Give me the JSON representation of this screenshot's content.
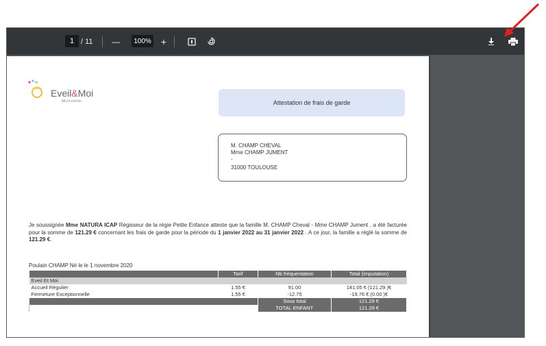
{
  "toolbar": {
    "current_page": "1",
    "page_total": "/ 11",
    "zoom_out_label": "—",
    "zoom_value": "100%",
    "zoom_in_label": "+",
    "fit_icon": "fit-page-icon",
    "rotate_icon": "rotate-icon",
    "download_icon": "download-icon",
    "print_icon": "print-icon"
  },
  "document": {
    "logo_name": "Eveil",
    "logo_amp": "&",
    "logo_name2": "Moi",
    "logo_sub": "Micro-crèche",
    "title": "Attestation de frais de garde",
    "address": [
      "M. CHAMP CHEVAL",
      "Mme CHAMP JUMENT",
      "-",
      "31000 TOULOUSE"
    ],
    "body": {
      "p1": "Je soussignée ",
      "signer": "Mme NATURA ICAP",
      "p2": " Régisseur de la régie Petite Enfance atteste que la famille M. CHAMP Cheval - Mme CHAMP Jument , a été facturée pour la somme de ",
      "amount1": "121.29 €",
      "p3": " concernant les frais de garde pour la période du ",
      "period": "1 janvier 2022 au 31 janvier 2022",
      "p4": " . A ce jour, la famille a réglé la somme de ",
      "amount2": "121.29 €",
      "p5": "."
    },
    "child_line": "Poulain CHAMP Né le le 1 novembre 2020",
    "table": {
      "headers": [
        "Tarif",
        "Nb fréquentation",
        "Total (imputation)"
      ],
      "group": "Eveil Et Moi",
      "rows": [
        {
          "label": "Accueil Régulier",
          "tarif": "1.55 €",
          "nb": "91.00",
          "total": "141.05 € (121.29 )€"
        },
        {
          "label": "Fermeture Exceptionnelle",
          "tarif": "1.55 €",
          "nb": "-12.75",
          "total": "-19.76 € (0.00 )€"
        }
      ],
      "subtotal_label": "Sous total",
      "subtotal_value": "121.29 €",
      "total_label": "TOTAL ENFANT",
      "total_value": "121.29 €"
    }
  },
  "annotation": {
    "arrow_color": "#e02020"
  }
}
